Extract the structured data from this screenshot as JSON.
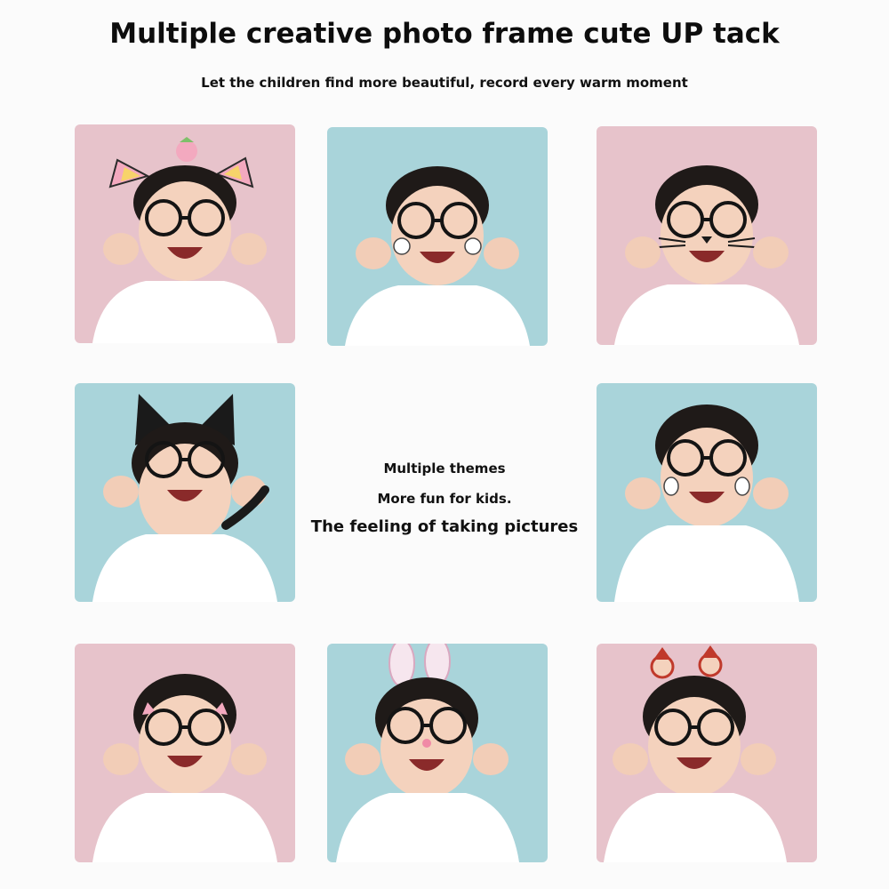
{
  "header": {
    "title": "Multiple creative photo frame cute UP tack",
    "subtitle": "Let the children find more beautiful, record every warm moment"
  },
  "center": {
    "line1": "Multiple themes",
    "line2": "More fun for kids.",
    "line3": "The feeling of taking pictures"
  },
  "colors": {
    "pink_background": "#e7c3cb",
    "blue_background": "#a9d4da"
  },
  "frames": [
    {
      "id": "frame-1",
      "background": "pink",
      "accessory": "pink-cat-ears-with-strawberry"
    },
    {
      "id": "frame-2",
      "background": "blue",
      "accessory": "cheek-stickers"
    },
    {
      "id": "frame-3",
      "background": "pink",
      "accessory": "cat-whiskers-nose"
    },
    {
      "id": "frame-4",
      "background": "blue",
      "accessory": "black-cat-ears-and-tail"
    },
    {
      "id": "frame-5",
      "background": "blue",
      "accessory": "bunny-cheek-stickers"
    },
    {
      "id": "frame-6",
      "background": "pink",
      "accessory": "small-cat-ears-on-glasses"
    },
    {
      "id": "frame-7",
      "background": "blue",
      "accessory": "glitter-bunny-ears"
    },
    {
      "id": "frame-8",
      "background": "pink",
      "accessory": "santa-headband"
    }
  ]
}
